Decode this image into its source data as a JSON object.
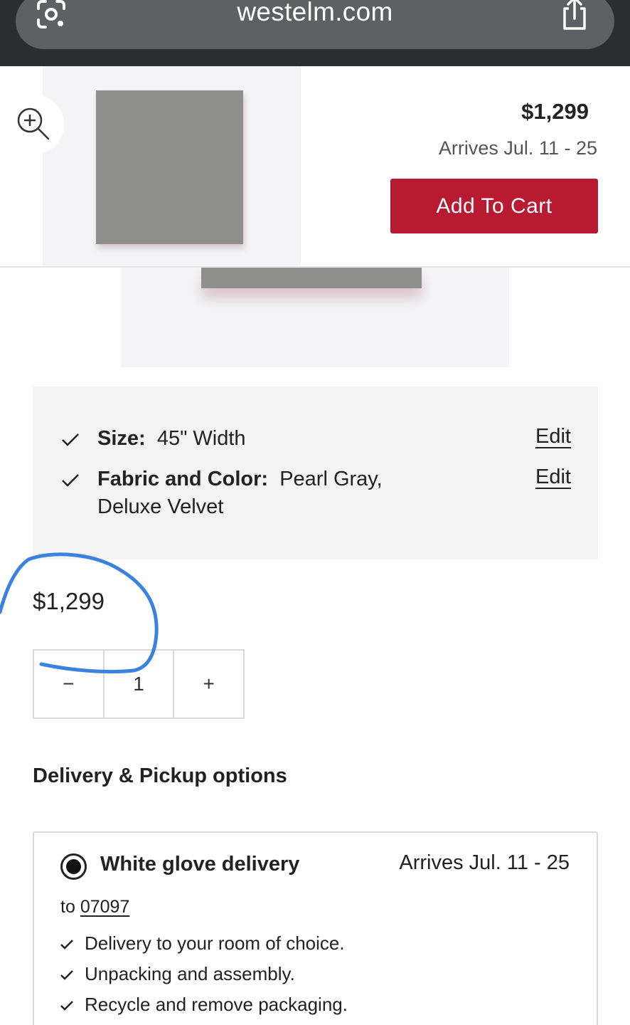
{
  "browser": {
    "url": "westelm.com"
  },
  "sticky": {
    "price": "$1,299",
    "arrives": "Arrives Jul. 11 - 25",
    "add_to_cart_label": "Add To Cart"
  },
  "options": {
    "items": [
      {
        "label": "Size:",
        "value": "45\" Width",
        "edit_label": "Edit"
      },
      {
        "label": "Fabric and Color:",
        "value": "Pearl Gray,",
        "value_line2": "Deluxe Velvet",
        "edit_label": "Edit"
      }
    ]
  },
  "pricing": {
    "price": "$1,299"
  },
  "quantity": {
    "decrement_label": "−",
    "value": "1",
    "increment_label": "+"
  },
  "delivery": {
    "heading": "Delivery & Pickup options",
    "method": {
      "title": "White glove delivery",
      "arrives": "Arrives Jul. 11 - 25",
      "to_prefix": "to",
      "zip": "07097",
      "selected": true,
      "features": [
        "Delivery to your room of choice.",
        "Unpacking and assembly.",
        "Recycle and remove packaging."
      ]
    }
  },
  "colors": {
    "add_to_cart_bg": "#b81a31",
    "annotation": "#3b82e0",
    "options_bg": "#f3f3f3"
  }
}
